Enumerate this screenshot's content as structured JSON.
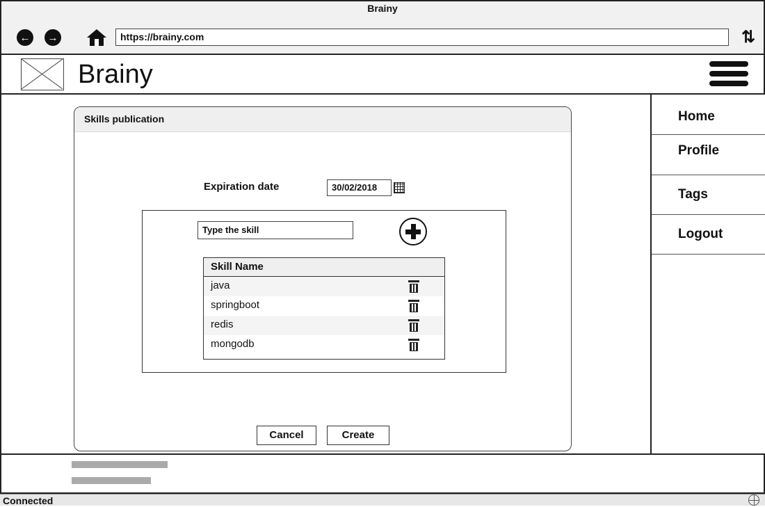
{
  "window": {
    "title": "Brainy"
  },
  "browser": {
    "url": "https://brainy.com",
    "icons": [
      "back-icon",
      "forward-icon",
      "home-icon",
      "refresh-icon"
    ]
  },
  "app": {
    "brand": "Brainy"
  },
  "nav": {
    "items": [
      {
        "label": "Home"
      },
      {
        "label": "Profile"
      },
      {
        "label": "Tags"
      },
      {
        "label": "Logout"
      }
    ]
  },
  "dialog": {
    "title": "Skills publication",
    "expiration_label": "Expiration date",
    "expiration_value": "30/02/2018",
    "skill_input_value": "Type the skill",
    "table": {
      "header": "Skill Name",
      "rows": [
        "java",
        "springboot",
        "redis",
        "mongodb"
      ]
    },
    "cancel_label": "Cancel",
    "create_label": "Create"
  },
  "status": {
    "text": "Connected"
  }
}
